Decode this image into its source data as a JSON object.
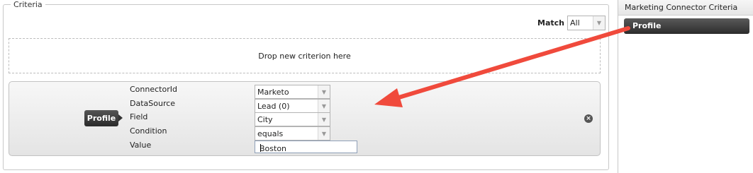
{
  "criteria": {
    "legend": "Criteria",
    "match": {
      "label": "Match",
      "value": "All"
    },
    "drop_zone": "Drop new criterion here",
    "criterion": {
      "chip": "Profile",
      "fields": [
        {
          "label": "ConnectorId",
          "value": "Marketo",
          "type": "select"
        },
        {
          "label": "DataSource",
          "value": "Lead (0)",
          "type": "select"
        },
        {
          "label": "Field",
          "value": "City",
          "type": "select"
        },
        {
          "label": "Condition",
          "value": "equals",
          "type": "select"
        },
        {
          "label": "Value",
          "value": "Boston",
          "type": "text"
        }
      ]
    }
  },
  "sidebar": {
    "title": "Marketing Connector Criteria",
    "items": [
      {
        "label": "Profile"
      }
    ]
  },
  "icons": {
    "dropdown": "chevron-down-icon",
    "remove": "close-circle-icon"
  },
  "colors": {
    "annotation_arrow": "#f04a3c",
    "chip_dark": "#2c2c2c"
  }
}
